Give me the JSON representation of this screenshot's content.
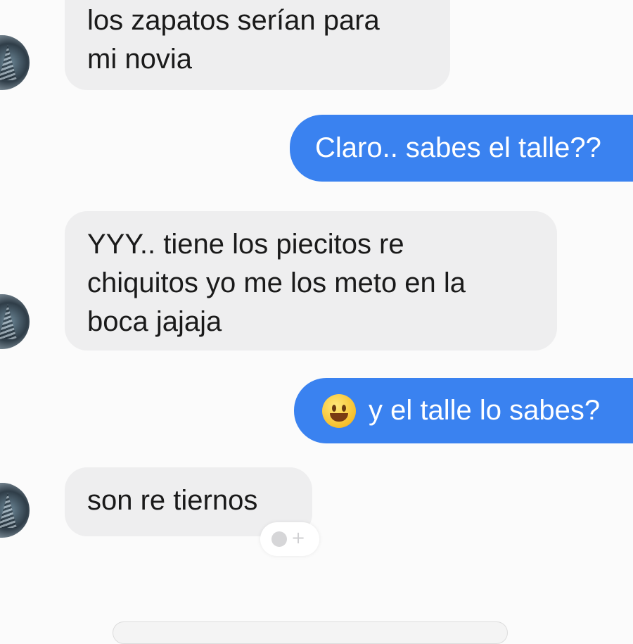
{
  "conversation": {
    "messages": [
      {
        "direction": "incoming",
        "text": "los zapatos serían para\nmi novia"
      },
      {
        "direction": "outgoing",
        "text": "Claro.. sabes el talle??"
      },
      {
        "direction": "incoming",
        "text": "YYY.. tiene los piecitos re\nchiquitos yo me los meto en la\nboca jajaja"
      },
      {
        "direction": "outgoing",
        "emoji": "grinning-face-icon",
        "text": "y el talle lo sabes?"
      },
      {
        "direction": "incoming",
        "text": "son re tiernos"
      }
    ]
  },
  "colors": {
    "outgoing_bubble": "#3a82f0",
    "incoming_bubble": "#eeeeef",
    "background": "#fbfbfb"
  },
  "icons": {
    "reaction": "add-reaction-icon",
    "avatar": "contact-avatar"
  }
}
